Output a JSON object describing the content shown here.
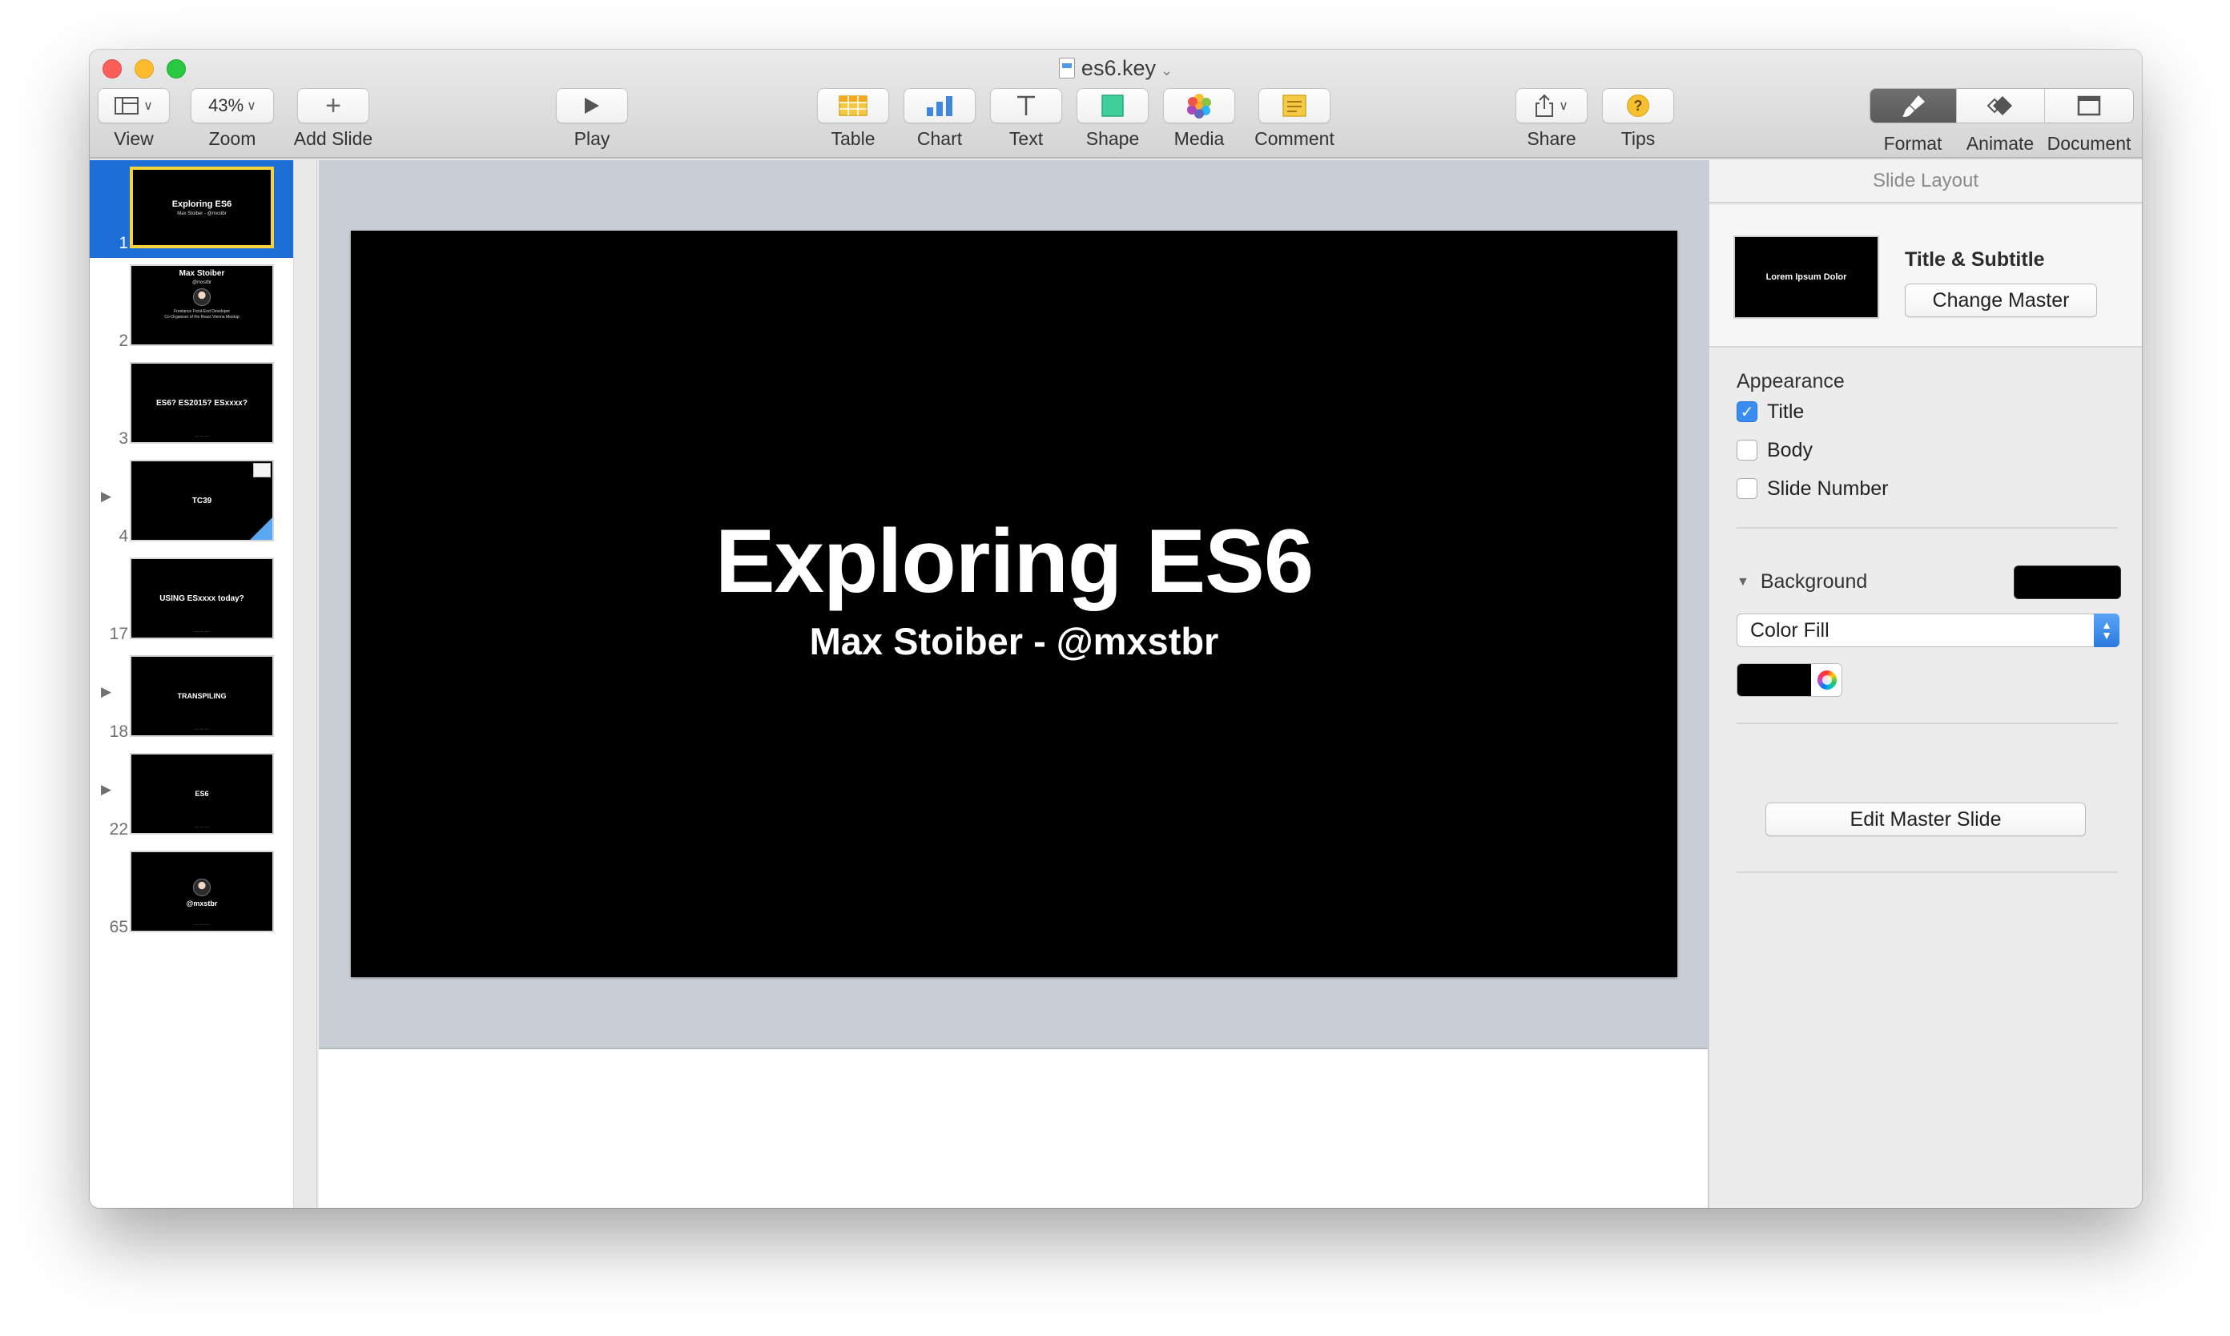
{
  "window": {
    "title": "es6.key"
  },
  "toolbar": {
    "view_label": "View",
    "zoom_value": "43%",
    "zoom_label": "Zoom",
    "add_slide_label": "Add Slide",
    "play_label": "Play",
    "table_label": "Table",
    "chart_label": "Chart",
    "text_label": "Text",
    "shape_label": "Shape",
    "media_label": "Media",
    "comment_label": "Comment",
    "share_label": "Share",
    "tips_label": "Tips",
    "format_label": "Format",
    "animate_label": "Animate",
    "document_label": "Document"
  },
  "navigator": {
    "slides": [
      {
        "number": "1",
        "title": "Exploring ES6",
        "subtitle": "Max Stoiber - @mxstbr",
        "selected": true
      },
      {
        "number": "2",
        "title": "Max Stoiber",
        "subtitle": "@mxstbr",
        "line1": "Freelance Front-End Developer",
        "line2": "Co-Organiser of the React Vienna Meetup"
      },
      {
        "number": "3",
        "title": "ES6? ES2015? ESxxxx?"
      },
      {
        "number": "4",
        "title": "TC39",
        "collapsed": true
      },
      {
        "number": "17",
        "title": "USING ESxxxx today?"
      },
      {
        "number": "18",
        "title": "TRANSPILING",
        "collapsed": true
      },
      {
        "number": "22",
        "title": "ES6",
        "collapsed": true
      },
      {
        "number": "65",
        "title": "@mxstbr"
      }
    ]
  },
  "slide": {
    "title": "Exploring ES6",
    "subtitle": "Max Stoiber - @mxstbr",
    "background": "#000000"
  },
  "inspector": {
    "header": "Slide Layout",
    "layout_name": "Title & Subtitle",
    "layout_thumb_text": "Lorem Ipsum Dolor",
    "change_master_label": "Change Master",
    "appearance_label": "Appearance",
    "checkboxes": [
      {
        "label": "Title",
        "checked": true
      },
      {
        "label": "Body",
        "checked": false
      },
      {
        "label": "Slide Number",
        "checked": false
      }
    ],
    "background_label": "Background",
    "fill_type": "Color Fill",
    "fill_color": "#000000",
    "edit_master_label": "Edit Master Slide"
  },
  "colors": {
    "selection_blue": "#1c6fd6",
    "selected_thumb_border": "#f7d23a",
    "checkbox_blue": "#3b8cf0"
  }
}
